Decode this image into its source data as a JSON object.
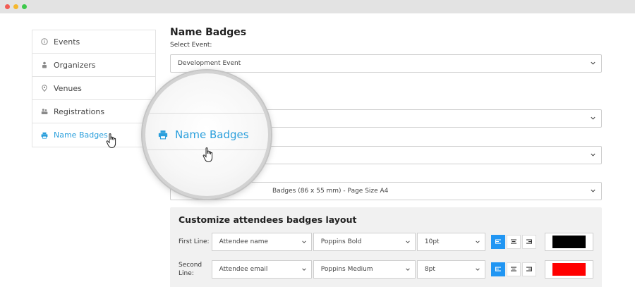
{
  "window": {
    "controls": [
      "close",
      "minimize",
      "maximize"
    ]
  },
  "sidebar": {
    "items": [
      {
        "label": "Events",
        "icon": "info-circle-icon",
        "active": false
      },
      {
        "label": "Organizers",
        "icon": "organizer-icon",
        "active": false
      },
      {
        "label": "Venues",
        "icon": "map-pin-icon",
        "active": false
      },
      {
        "label": "Registrations",
        "icon": "registrations-icon",
        "active": false
      },
      {
        "label": "Name Badges",
        "icon": "printer-icon",
        "active": true
      }
    ]
  },
  "main": {
    "title": "Name Badges",
    "select_event_label": "Select Event:",
    "select_event_value": "Development Event",
    "badge_size_value": "Badges (86 x 55 mm) - Page Size A4"
  },
  "magnifier": {
    "label": "Name Badges"
  },
  "customize": {
    "title": "Customize attendees badges layout",
    "rows": [
      {
        "label": "First Line:",
        "field": "Attendee name",
        "font": "Poppins Bold",
        "size": "10pt",
        "align": "left",
        "color": "#000000"
      },
      {
        "label": "Second Line:",
        "field": "Attendee email",
        "font": "Poppins Medium",
        "size": "8pt",
        "align": "left",
        "color": "#ff0000"
      }
    ]
  },
  "colors": {
    "accent": "#2a9fdc",
    "align_active": "#2196f3"
  }
}
